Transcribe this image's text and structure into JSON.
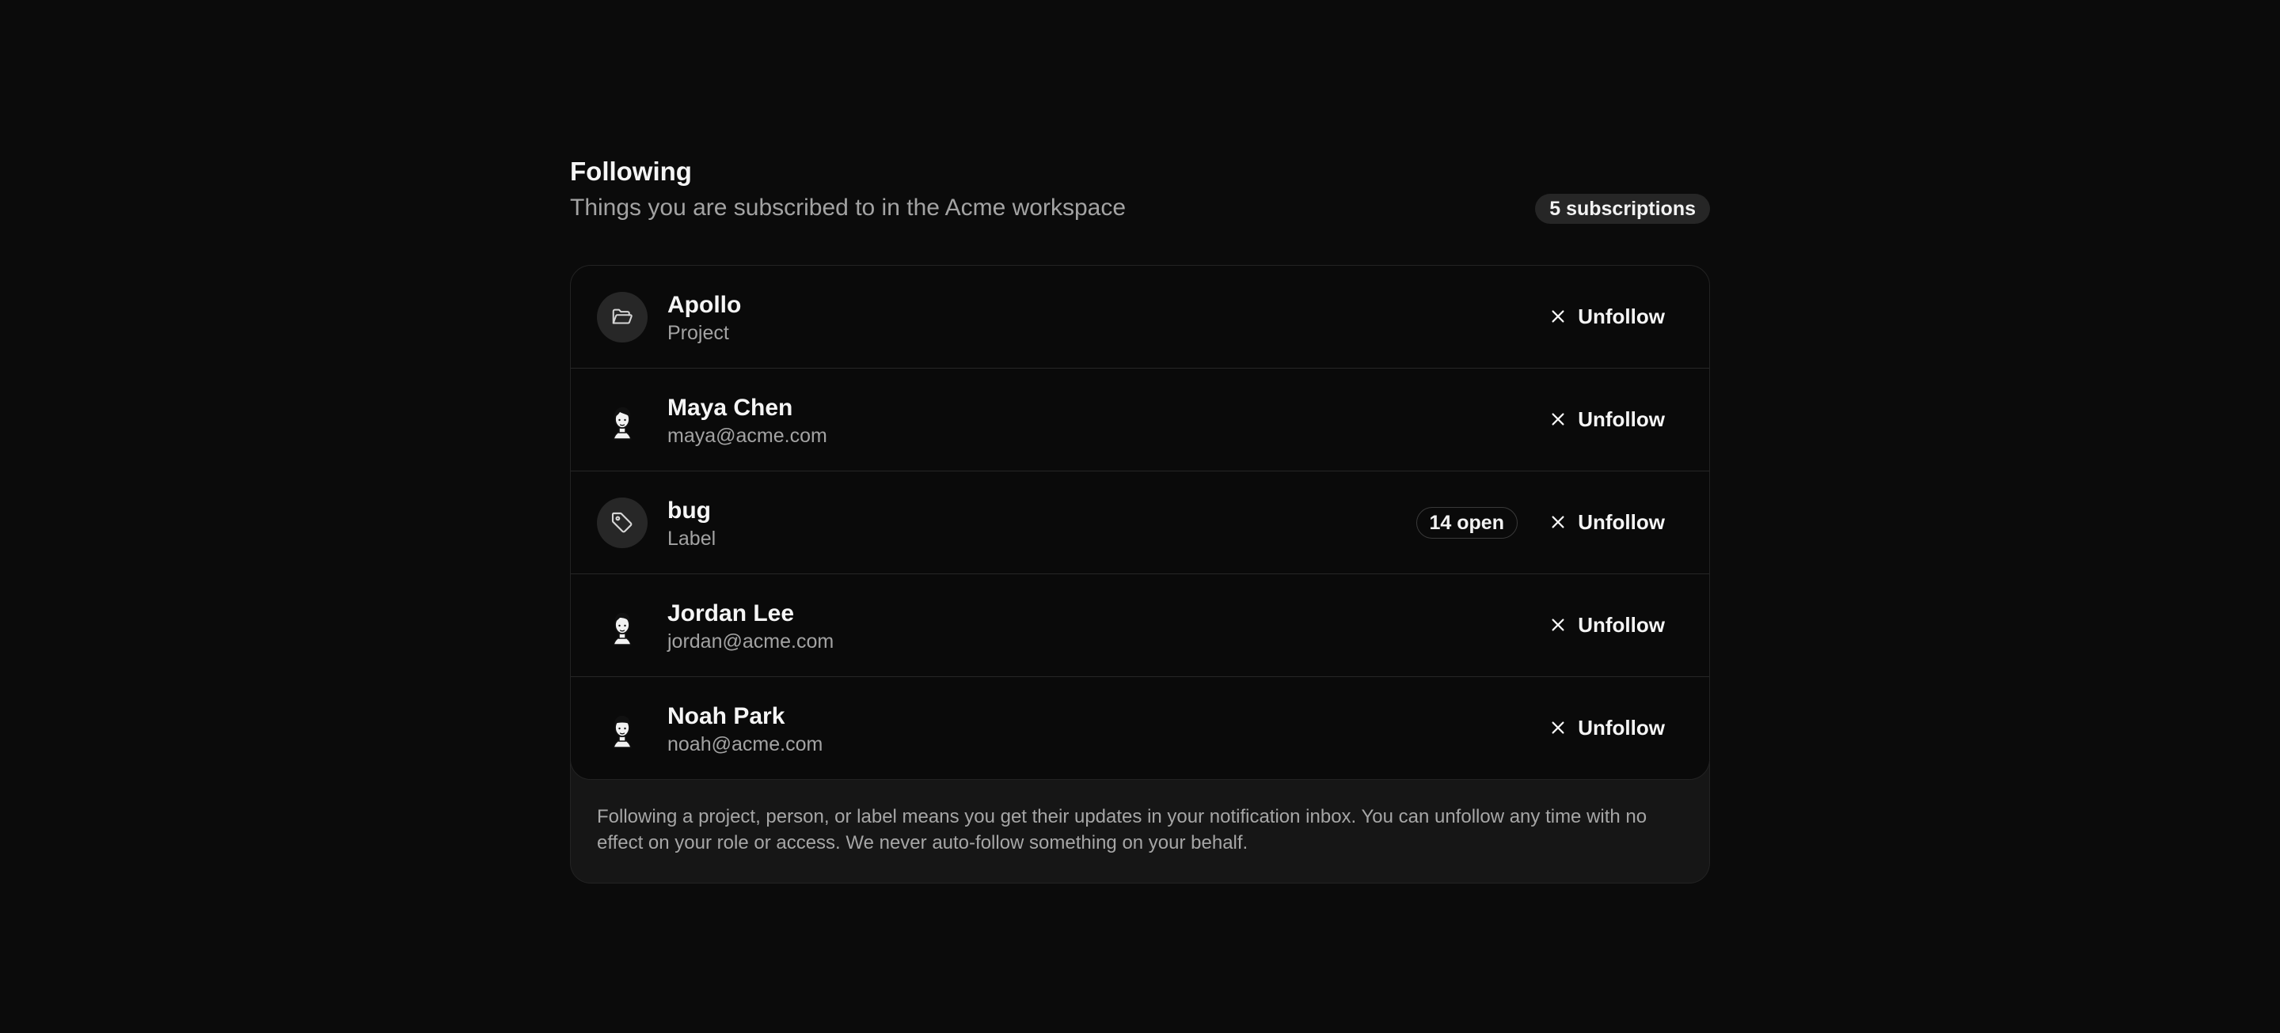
{
  "header": {
    "title": "Following",
    "subtitle": "Things you are subscribed to in the Acme workspace",
    "count_badge": "5 subscriptions"
  },
  "subscriptions": [
    {
      "name": "Apollo",
      "sub": "Project",
      "icon": "folder-open-icon",
      "badge": ""
    },
    {
      "name": "Maya Chen",
      "sub": "maya@acme.com",
      "icon": "person-avatar",
      "badge": ""
    },
    {
      "name": "bug",
      "sub": "Label",
      "icon": "tag-icon",
      "badge": "14 open"
    },
    {
      "name": "Jordan Lee",
      "sub": "jordan@acme.com",
      "icon": "person-avatar",
      "badge": ""
    },
    {
      "name": "Noah Park",
      "sub": "noah@acme.com",
      "icon": "person-avatar",
      "badge": ""
    }
  ],
  "unfollow_label": "Unfollow",
  "note": "Following a project, person, or label means you get their updates in your notification inbox. You can unfollow any time with no effect on your role or access. We never auto-follow something on your behalf."
}
